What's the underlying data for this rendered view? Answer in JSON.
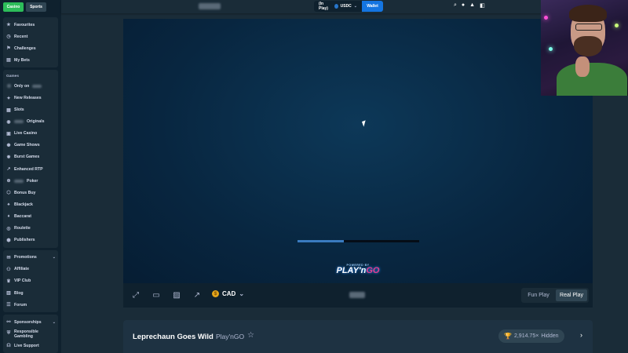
{
  "top_tabs": {
    "casino": "Casino",
    "sports": "Sports"
  },
  "sidebar": {
    "group1": [
      {
        "label": "Favourites",
        "icon": "star-icon"
      },
      {
        "label": "Recent",
        "icon": "clock-icon"
      },
      {
        "label": "Challenges",
        "icon": "challenge-icon"
      },
      {
        "label": "My Bets",
        "icon": "bets-icon"
      }
    ],
    "games_heading": "Games",
    "games": [
      {
        "prefix": "",
        "label": "Only on",
        "icon": "logo-icon",
        "blur_after": true
      },
      {
        "prefix": "",
        "label": "New Releases",
        "icon": "new-icon"
      },
      {
        "prefix": "",
        "label": "Slots",
        "icon": "slots-icon"
      },
      {
        "prefix": "",
        "label": "Originals",
        "icon": "originals-icon",
        "blur_before": true
      },
      {
        "prefix": "",
        "label": "Live Casino",
        "icon": "live-icon"
      },
      {
        "prefix": "",
        "label": "Game Shows",
        "icon": "gameshow-icon"
      },
      {
        "prefix": "",
        "label": "Burst Games",
        "icon": "burst-icon"
      },
      {
        "prefix": "",
        "label": "Enhanced RTP",
        "icon": "rtp-icon"
      },
      {
        "prefix": "",
        "label": "Poker",
        "icon": "poker-icon",
        "blur_before": true
      },
      {
        "prefix": "",
        "label": "Bonus Buy",
        "icon": "bonus-icon"
      },
      {
        "prefix": "",
        "label": "Blackjack",
        "icon": "blackjack-icon"
      },
      {
        "prefix": "",
        "label": "Baccarat",
        "icon": "baccarat-icon"
      },
      {
        "prefix": "",
        "label": "Roulette",
        "icon": "roulette-icon"
      },
      {
        "prefix": "",
        "label": "Publishers",
        "icon": "publishers-icon"
      }
    ],
    "group3": [
      {
        "label": "Promotions",
        "icon": "gift-icon",
        "chevron": true
      },
      {
        "label": "Affiliate",
        "icon": "affiliate-icon"
      },
      {
        "label": "VIP Club",
        "icon": "vip-icon"
      },
      {
        "label": "Blog",
        "icon": "blog-icon"
      },
      {
        "label": "Forum",
        "icon": "forum-icon"
      }
    ],
    "group4": [
      {
        "label": "Sponsorships",
        "icon": "handshake-icon",
        "chevron": true
      },
      {
        "label": "Responsible Gambling",
        "icon": "shield-icon"
      },
      {
        "label": "Live Support",
        "icon": "headset-icon"
      }
    ]
  },
  "header": {
    "balance_label": "(In Play)",
    "currency": "USDC",
    "wallet_label": "Wallet"
  },
  "game": {
    "loading_progress": 0.38,
    "provider_small": "POWERED BY",
    "provider_big_a": "PLAY'n",
    "provider_big_b": "GO"
  },
  "controls": {
    "currency": "CAD",
    "coin_symbol": "$",
    "fun_play": "Fun Play",
    "real_play": "Real Play"
  },
  "details": {
    "title": "Leprechaun Goes Wild",
    "provider": "Play'nGO",
    "multiplier": "2,914.75×",
    "visibility": "Hidden"
  },
  "colors": {
    "accent_green": "#2dbd5a",
    "wallet_blue": "#1475e1",
    "sidebar_bg": "#0f212e",
    "page_bg": "#1a2c38"
  }
}
